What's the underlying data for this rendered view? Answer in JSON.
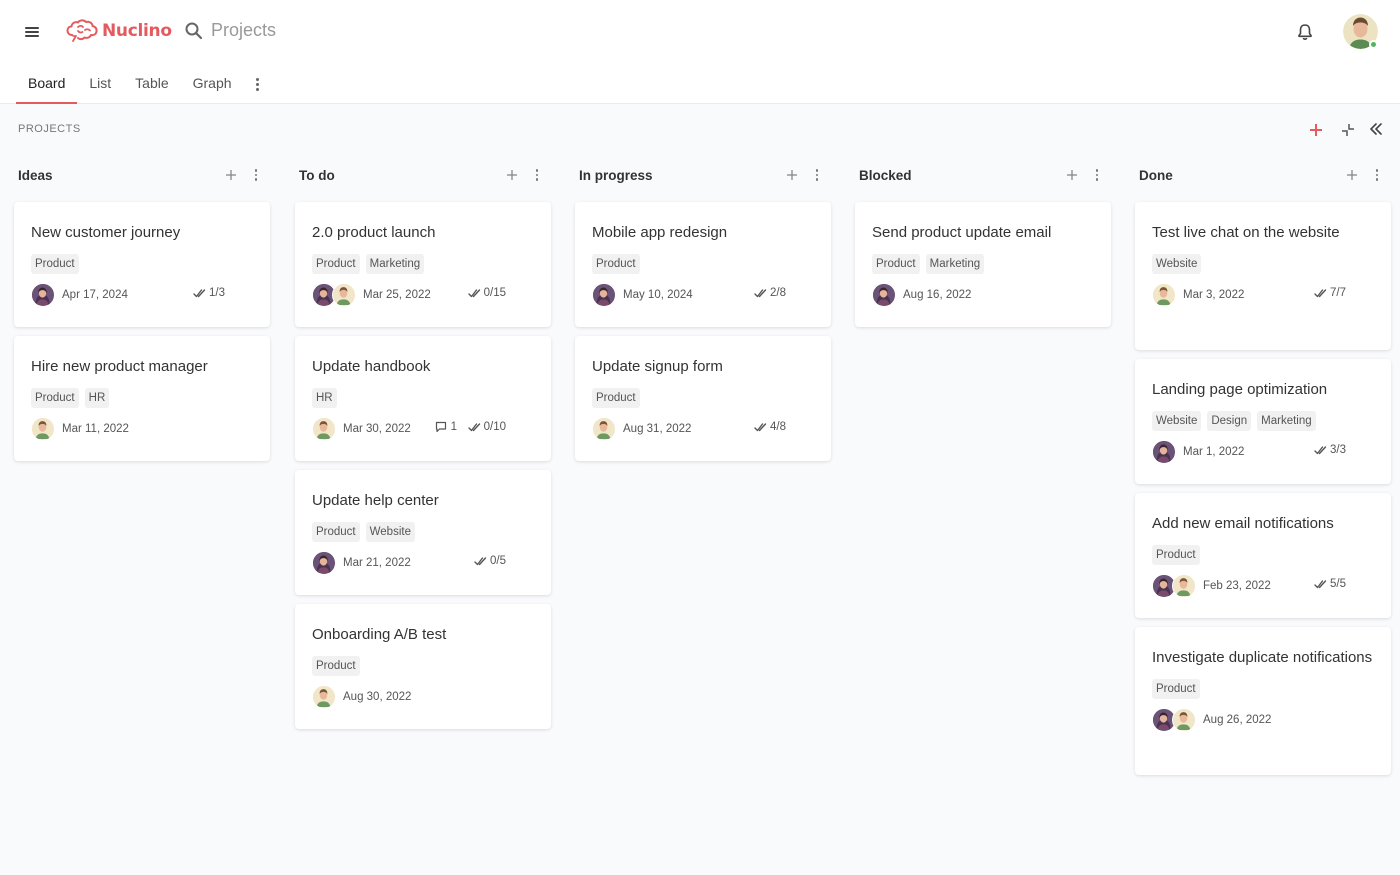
{
  "app": {
    "name": "Nuclino",
    "brand_color": "#e45a5f"
  },
  "search": {
    "label": "Projects"
  },
  "tabs": [
    "Board",
    "List",
    "Table",
    "Graph"
  ],
  "active_tab": "Board",
  "board": {
    "title": "PROJECTS"
  },
  "columns": [
    {
      "name": "Ideas",
      "cards": [
        {
          "title": "New customer journey",
          "tags": [
            "Product"
          ],
          "avatars": [
            "a"
          ],
          "date": "Apr 17, 2024",
          "checklist": "1/3"
        },
        {
          "title": "Hire new product manager",
          "tags": [
            "Product",
            "HR"
          ],
          "avatars": [
            "b"
          ],
          "date": "Mar 11, 2022"
        }
      ]
    },
    {
      "name": "To do",
      "cards": [
        {
          "title": "2.0 product launch",
          "tags": [
            "Product",
            "Marketing"
          ],
          "avatars": [
            "a",
            "b"
          ],
          "date": "Mar 25, 2022",
          "checklist": "0/15"
        },
        {
          "title": "Update handbook",
          "tags": [
            "HR"
          ],
          "avatars": [
            "b"
          ],
          "date": "Mar 30, 2022",
          "comments": "1",
          "checklist": "0/10"
        },
        {
          "title": "Update help center",
          "tags": [
            "Product",
            "Website"
          ],
          "avatars": [
            "a"
          ],
          "date": "Mar 21, 2022",
          "checklist": "0/5"
        },
        {
          "title": "Onboarding A/B test",
          "tags": [
            "Product"
          ],
          "avatars": [
            "b"
          ],
          "date": "Aug 30, 2022"
        }
      ]
    },
    {
      "name": "In progress",
      "cards": [
        {
          "title": "Mobile app redesign",
          "tags": [
            "Product"
          ],
          "avatars": [
            "a"
          ],
          "date": "May 10, 2024",
          "checklist": "2/8"
        },
        {
          "title": "Update signup form",
          "tags": [
            "Product"
          ],
          "avatars": [
            "b"
          ],
          "date": "Aug 31, 2022",
          "checklist": "4/8"
        }
      ]
    },
    {
      "name": "Blocked",
      "cards": [
        {
          "title": "Send product update email",
          "tags": [
            "Product",
            "Marketing"
          ],
          "avatars": [
            "a"
          ],
          "date": "Aug 16, 2022"
        }
      ]
    },
    {
      "name": "Done",
      "cards": [
        {
          "title": "Test live chat on the website",
          "tags": [
            "Website"
          ],
          "avatars": [
            "b"
          ],
          "date": "Mar 3, 2022",
          "checklist": "7/7"
        },
        {
          "title": "Landing page optimization",
          "tags": [
            "Website",
            "Design",
            "Marketing"
          ],
          "avatars": [
            "a"
          ],
          "date": "Mar 1, 2022",
          "checklist": "3/3"
        },
        {
          "title": "Add new email notifications",
          "tags": [
            "Product"
          ],
          "avatars": [
            "a",
            "b"
          ],
          "date": "Feb 23, 2022",
          "checklist": "5/5"
        },
        {
          "title": "Investigate duplicate notifications",
          "tags": [
            "Product"
          ],
          "avatars": [
            "a",
            "b"
          ],
          "date": "Aug 26, 2022"
        }
      ]
    }
  ],
  "icons": [
    "menu-icon",
    "brain-logo-icon",
    "search-icon",
    "bell-icon",
    "plus-icon",
    "more-vertical-icon",
    "collapse-icon",
    "chevrons-left-icon",
    "checkmark-icon",
    "comment-icon"
  ]
}
